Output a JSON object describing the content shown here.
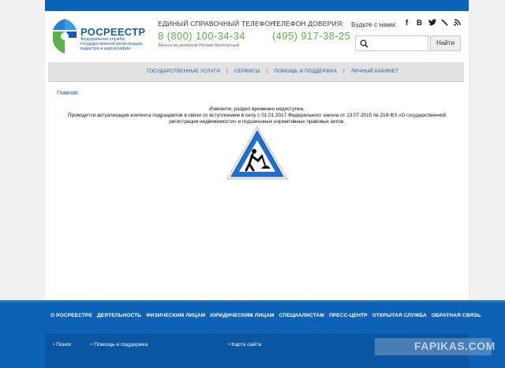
{
  "header": {
    "logo_title": "РОСРЕЕСТР",
    "logo_subtitle": "Федеральная служба государственной регистрации, кадастра и картографии",
    "help_phone_label": "ЕДИНЫЙ СПРАВОЧНЫЙ ТЕЛЕФОН:",
    "help_phone": "8 (800) 100-34-34",
    "help_phone_note": "Звонок из регионов России бесплатный",
    "trust_phone_label": "ТЕЛЕФОН ДОВЕРИЯ:",
    "trust_phone": "(495) 917-38-25",
    "social_label": "Будьте с нами:",
    "social": [
      "facebook-icon",
      "vk-icon",
      "twitter-icon",
      "livejournal-icon",
      "rss-icon"
    ],
    "search_placeholder": "",
    "search_button": "Найти"
  },
  "nav": [
    "ГОСУДАРСТВЕННЫЕ УСЛУГИ",
    "СЕРВИСЫ",
    "ПОМОЩЬ И ПОДДЕРЖКА",
    "ЛИЧНЫЙ КАБИНЕТ"
  ],
  "breadcrumb": "Главная",
  "notice": {
    "line1": "Извините, раздел временно недоступен.",
    "line2": "Проводится актуализация контента подразделов в связи со вступлением в силу с 01.01.2017 Федерального закона от 13.07.2015 № 218-ФЗ «О государственной регистрации недвижимости» и подзаконных нормативных правовых актов."
  },
  "footer": {
    "nav": [
      "О РОСРЕЕСТРЕ",
      "ДЕЯТЕЛЬНОСТЬ",
      "ФИЗИЧЕСКИМ ЛИЦАМ",
      "ЮРИДИЧЕСКИМ ЛИЦАМ",
      "СПЕЦИАЛИСТАМ",
      "ПРЕСС-ЦЕНТР",
      "ОТКРЫТАЯ СЛУЖБА",
      "ОБРАТНАЯ СВЯЗЬ"
    ],
    "links": [
      "Поиск",
      "Помощь и поддержка",
      "Карта сайта"
    ],
    "watermark": "FAPIKAS.COM"
  },
  "colors": {
    "brand_blue": "#1e5aa8",
    "phone_green": "#5cb246",
    "footer_blue": "#0d62b6"
  }
}
